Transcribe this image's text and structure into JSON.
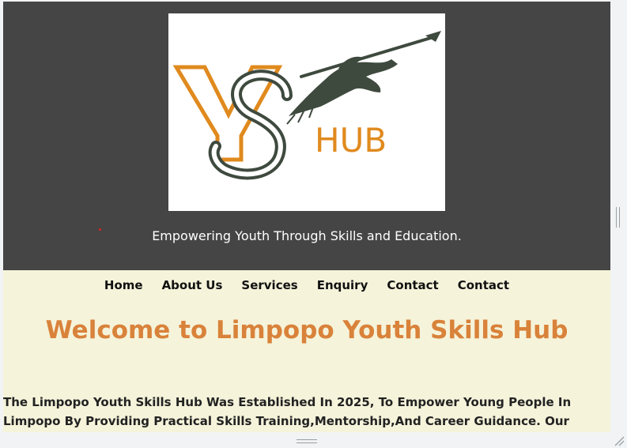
{
  "header": {
    "logo": {
      "letters": "YS",
      "word": "HUB"
    },
    "tagline": "Empowering Youth Through Skills and Education."
  },
  "nav": {
    "items": [
      {
        "label": "Home"
      },
      {
        "label": "About Us"
      },
      {
        "label": "Services"
      },
      {
        "label": "Enquiry"
      },
      {
        "label": "Contact"
      },
      {
        "label": "Contact"
      }
    ]
  },
  "main": {
    "title": "Welcome to Limpopo Youth Skills Hub",
    "intro": "The Limpopo Youth Skills Hub Was Established In 2025, To Empower Young People In Limpopo By Providing Practical Skills Training,Mentorship,And Career Guidance. Our Programs Are Designed To Help"
  },
  "colors": {
    "header_bg": "#454545",
    "page_bg": "#f5f3da",
    "accent": "#d9823a",
    "logo_dark": "#3f4a3f"
  }
}
